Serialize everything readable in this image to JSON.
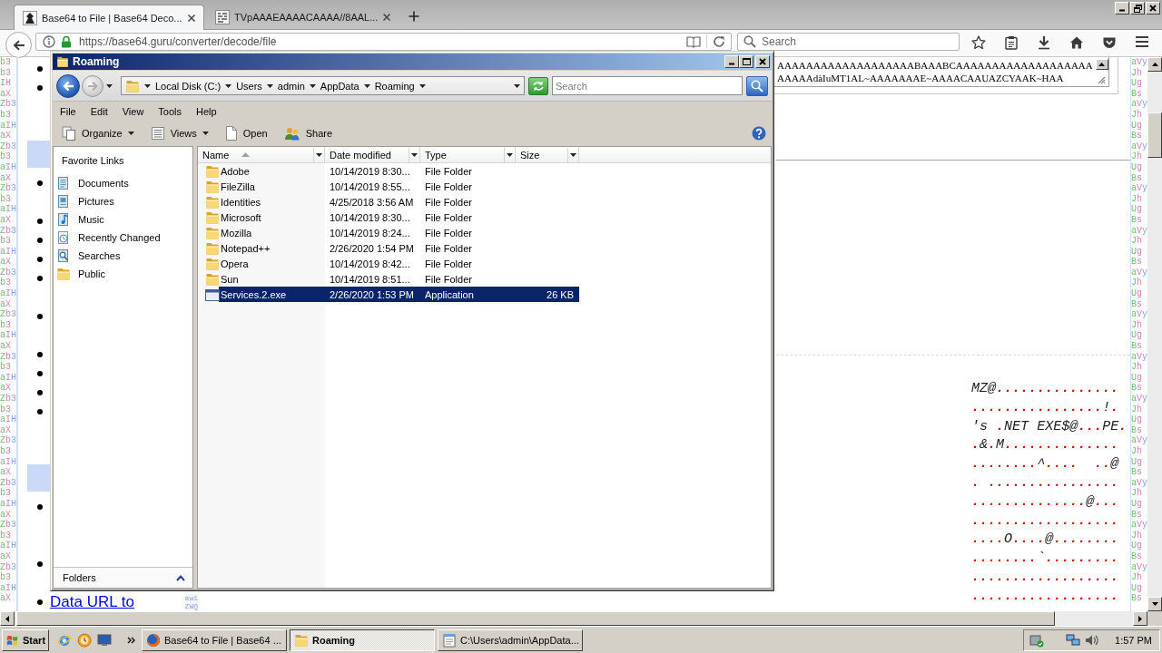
{
  "browser": {
    "tabs": [
      {
        "title": "Base64 to File | Base64 Deco...",
        "kind": "site",
        "selected": true
      },
      {
        "title": "TVpAAAEAAAACAAAA//8AAL...",
        "kind": "file",
        "selected": false
      }
    ],
    "address": {
      "url": "https://base64.guru/converter/decode/file"
    },
    "search": {
      "placeholder": "Search"
    },
    "page": {
      "left_text_column": [
        "b3",
        "b3",
        "IH",
        "aX",
        "Zb3",
        "b3",
        "aIH",
        "aX",
        "Zb3",
        "b3",
        "aIH",
        "aX",
        "Zb3",
        "b3",
        "aIH",
        "aX",
        "Zb3",
        "b3",
        "aIH",
        "aX",
        "Zb3",
        "b3",
        "aIH",
        "aX",
        "Zb3",
        "b3",
        "aIH",
        "aX",
        "Zb3",
        "b3",
        "aIH",
        "aX",
        "Zb3",
        "b3",
        "aIH",
        "aX",
        "Zb3",
        "b3",
        "aIH",
        "aX",
        "Zb3",
        "b3",
        "aIH",
        "aX",
        "Zb3",
        "b3",
        "aIH",
        "aX",
        "Zb3",
        "b3",
        "aIH",
        "aX"
      ],
      "list_rows": [
        {
          "kind": "bullet"
        },
        {
          "kind": "bullet"
        },
        {
          "kind": "blank"
        },
        {
          "kind": "blank"
        },
        {
          "kind": "highlight"
        },
        {
          "kind": "bullet"
        },
        {
          "kind": "blank"
        },
        {
          "kind": "bullet"
        },
        {
          "kind": "bullet"
        },
        {
          "kind": "bullet"
        },
        {
          "kind": "bullet"
        },
        {
          "kind": "blank"
        },
        {
          "kind": "bullet"
        },
        {
          "kind": "blank"
        },
        {
          "kind": "bullet"
        },
        {
          "kind": "bullet"
        },
        {
          "kind": "bullet"
        },
        {
          "kind": "bullet"
        },
        {
          "kind": "blank"
        },
        {
          "kind": "blank"
        },
        {
          "kind": "highlight"
        },
        {
          "kind": "bullet"
        },
        {
          "kind": "blank"
        },
        {
          "kind": "blank"
        },
        {
          "kind": "bullet"
        },
        {
          "kind": "blank"
        },
        {
          "kind": "link",
          "text": "Data URL to"
        }
      ],
      "fragments": [
        "aw1",
        "ZWQ"
      ],
      "textarea_lines": [
        "AAAAAAAAAAAAAAAAAAABAAABCAAAAAAAAAAAAAAAAAAA",
        "AAAAAdàIuMT1AL~AAAAAAAE~AAAACAAUAZCYAAK~HAA"
      ],
      "hex_lines": [
        "MZ@...............",
        "................!.",
        "'s .NET EXE$@...PE.",
        ".&.M..............",
        "........^....  ..@",
        ". ................",
        "..............@...",
        "..................",
        "....O....@........",
        "........`.........",
        "..................",
        ".................."
      ],
      "right_text_column": [
        "aVy",
        "Jh",
        "Ug",
        "Bs",
        "aVy",
        "Jh",
        "Ug",
        "Bs",
        "aVy",
        "Jh",
        "Ug",
        "Bs",
        "aVy",
        "Jh",
        "Ug",
        "Bs",
        "aVy",
        "Jh",
        "Ug",
        "Bs",
        "aVy",
        "Jh",
        "Ug",
        "Bs",
        "aVy",
        "Jh",
        "Ug",
        "Bs",
        "aVy",
        "Jh",
        "Ug",
        "Bs",
        "aVy",
        "Jh",
        "Ug",
        "Bs",
        "aVy",
        "Jh",
        "Ug",
        "Bs",
        "aVy",
        "Jh",
        "Ug",
        "Bs",
        "aVy",
        "Jh",
        "Ug",
        "Bs",
        "aVy",
        "Jh",
        "Ug",
        "Bs"
      ]
    }
  },
  "explorer": {
    "title": "Roaming",
    "breadcrumb": [
      "Local Disk (C:)",
      "Users",
      "admin",
      "AppData",
      "Roaming"
    ],
    "search": {
      "placeholder": "Search"
    },
    "menu": [
      "File",
      "Edit",
      "View",
      "Tools",
      "Help"
    ],
    "toolbar": [
      {
        "label": "Organize",
        "kind": "organize",
        "dropdown": true
      },
      {
        "label": "Views",
        "kind": "views",
        "dropdown": true
      },
      {
        "label": "Open",
        "kind": "open",
        "dropdown": false
      },
      {
        "label": "Share",
        "kind": "share",
        "dropdown": false
      }
    ],
    "favorite_links": {
      "title": "Favorite Links",
      "items": [
        {
          "label": "Documents",
          "kind": "documents"
        },
        {
          "label": "Pictures",
          "kind": "pictures"
        },
        {
          "label": "Music",
          "kind": "music"
        },
        {
          "label": "Recently Changed",
          "kind": "recent"
        },
        {
          "label": "Searches",
          "kind": "searches"
        },
        {
          "label": "Public",
          "kind": "folder"
        }
      ]
    },
    "folders_bar": "Folders",
    "columns": [
      {
        "label": "Name",
        "sorted": true
      },
      {
        "label": "Date modified",
        "sorted": false
      },
      {
        "label": "Type",
        "sorted": false
      },
      {
        "label": "Size",
        "sorted": false
      }
    ],
    "rows": [
      {
        "name": "Adobe",
        "date": "10/14/2019 8:30...",
        "type": "File Folder",
        "kind": "folder",
        "selected": false
      },
      {
        "name": "FileZilla",
        "date": "10/14/2019 8:55...",
        "type": "File Folder",
        "kind": "folder",
        "selected": false
      },
      {
        "name": "Identities",
        "date": "4/25/2018 3:56 AM",
        "type": "File Folder",
        "kind": "folder",
        "selected": false
      },
      {
        "name": "Microsoft",
        "date": "10/14/2019 8:30...",
        "type": "File Folder",
        "kind": "folder",
        "selected": false
      },
      {
        "name": "Mozilla",
        "date": "10/14/2019 8:24...",
        "type": "File Folder",
        "kind": "folder",
        "selected": false
      },
      {
        "name": "Notepad++",
        "date": "2/26/2020 1:54 PM",
        "type": "File Folder",
        "kind": "folder",
        "selected": false
      },
      {
        "name": "Opera",
        "date": "10/14/2019 8:42...",
        "type": "File Folder",
        "kind": "folder",
        "selected": false
      },
      {
        "name": "Sun",
        "date": "10/14/2019 8:51...",
        "type": "File Folder",
        "kind": "folder",
        "selected": false
      },
      {
        "name": "Services.2.exe",
        "date": "2/26/2020 1:53 PM",
        "type": "Application",
        "size": "26 KB",
        "kind": "application",
        "selected": true
      }
    ]
  },
  "taskbar": {
    "start": "Start",
    "tasks": [
      {
        "label": "Base64 to File | Base64 ...",
        "kind": "browser",
        "selected": false
      },
      {
        "label": "Roaming",
        "kind": "folder",
        "selected": true
      },
      {
        "label": "C:\\Users\\admin\\AppData...",
        "kind": "notepad",
        "selected": false
      }
    ],
    "clock": "1:57 PM"
  }
}
